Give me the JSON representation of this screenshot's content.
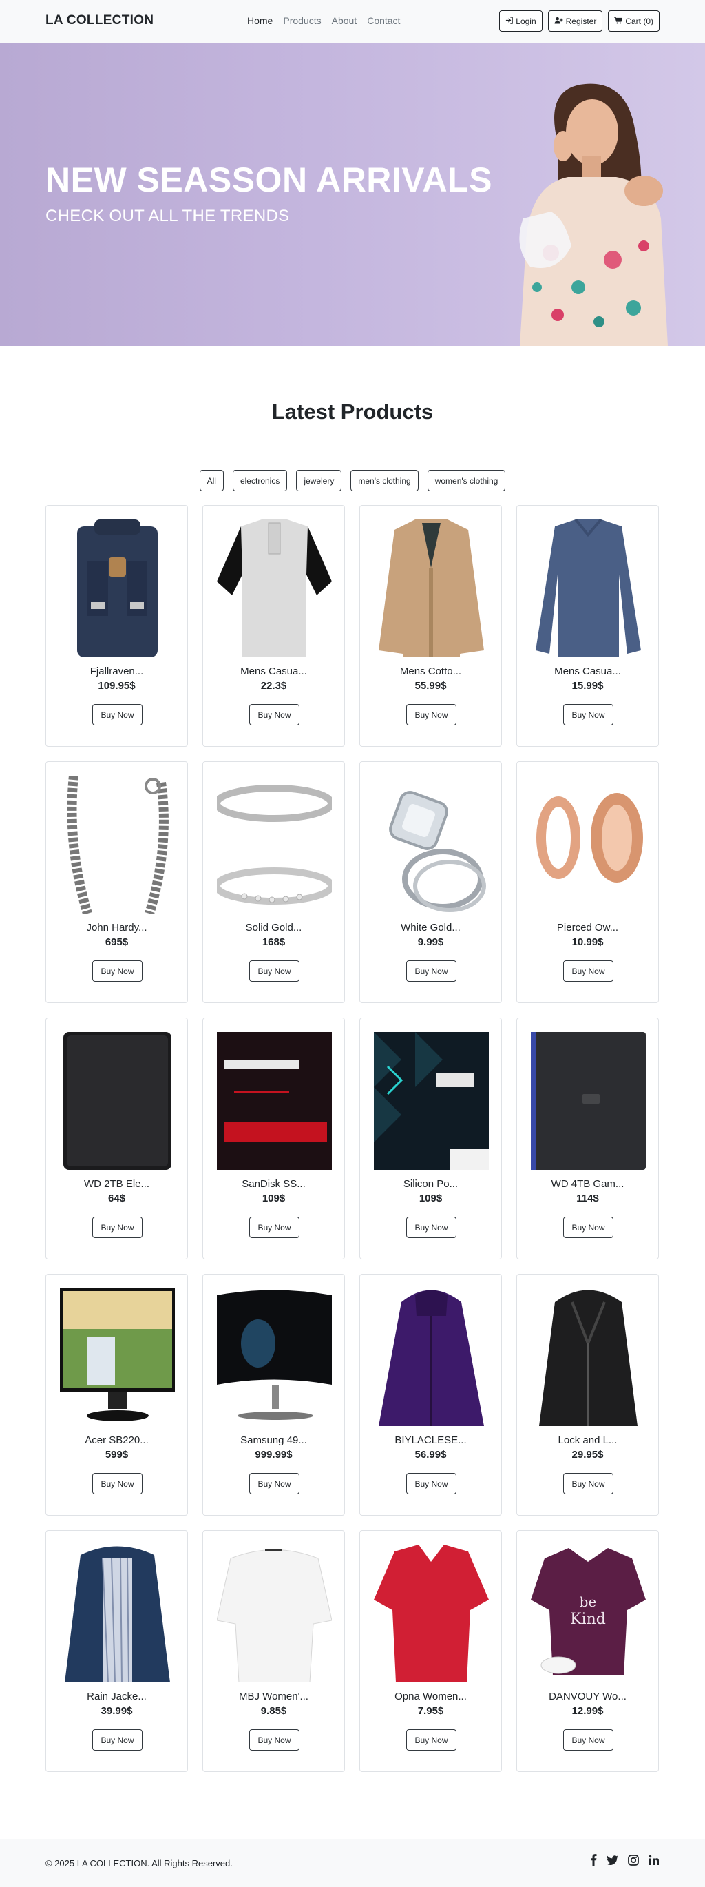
{
  "nav": {
    "brand": "LA COLLECTION",
    "links": [
      "Home",
      "Products",
      "About",
      "Contact"
    ],
    "login": "Login",
    "register": "Register",
    "cart": "Cart (0)"
  },
  "hero": {
    "title": "NEW SEASSON ARRIVALS",
    "subtitle": "CHECK OUT ALL THE TRENDS"
  },
  "products_section": {
    "title": "Latest Products",
    "filters": [
      "All",
      "electronics",
      "jewelery",
      "men's clothing",
      "women's clothing"
    ],
    "buy_label": "Buy Now",
    "items": [
      {
        "title": "Fjallraven...",
        "price": "109.95$",
        "icon": "backpack-image"
      },
      {
        "title": "Mens Casua...",
        "price": "22.3$",
        "icon": "tshirt-image"
      },
      {
        "title": "Mens Cotto...",
        "price": "55.99$",
        "icon": "jacket-image"
      },
      {
        "title": "Mens Casua...",
        "price": "15.99$",
        "icon": "longsleeve-image"
      },
      {
        "title": "John Hardy...",
        "price": "695$",
        "icon": "bracelet-image"
      },
      {
        "title": "Solid Gold...",
        "price": "168$",
        "icon": "ring-band-image"
      },
      {
        "title": "White Gold...",
        "price": "9.99$",
        "icon": "diamond-ring-image"
      },
      {
        "title": "Pierced Ow...",
        "price": "10.99$",
        "icon": "plug-earrings-image"
      },
      {
        "title": "WD 2TB Ele...",
        "price": "64$",
        "icon": "hard-drive-image"
      },
      {
        "title": "SanDisk SS...",
        "price": "109$",
        "icon": "ssd-image"
      },
      {
        "title": "Silicon Po...",
        "price": "109$",
        "icon": "ssd-image"
      },
      {
        "title": "WD 4TB Gam...",
        "price": "114$",
        "icon": "hard-drive-image"
      },
      {
        "title": "Acer SB220...",
        "price": "599$",
        "icon": "monitor-image"
      },
      {
        "title": "Samsung 49...",
        "price": "999.99$",
        "icon": "curved-monitor-image"
      },
      {
        "title": "BIYLACLESE...",
        "price": "56.99$",
        "icon": "purple-jacket-image"
      },
      {
        "title": "Lock and L...",
        "price": "29.95$",
        "icon": "leather-jacket-image"
      },
      {
        "title": "Rain Jacke...",
        "price": "39.99$",
        "icon": "rain-jacket-image"
      },
      {
        "title": "MBJ Women'...",
        "price": "9.85$",
        "icon": "white-top-image"
      },
      {
        "title": "Opna Women...",
        "price": "7.95$",
        "icon": "red-tshirt-image"
      },
      {
        "title": "DANVOUY Wo...",
        "price": "12.99$",
        "icon": "purple-tshirt-image"
      }
    ]
  },
  "footer": {
    "copyright": "© 2025 LA COLLECTION. All Rights Reserved.",
    "social": [
      "facebook-icon",
      "twitter-icon",
      "instagram-icon",
      "linkedin-icon"
    ]
  },
  "colors": {
    "hero_bg": "#c4b6de",
    "navbar_bg": "#f8f9fa",
    "text": "#212529"
  }
}
